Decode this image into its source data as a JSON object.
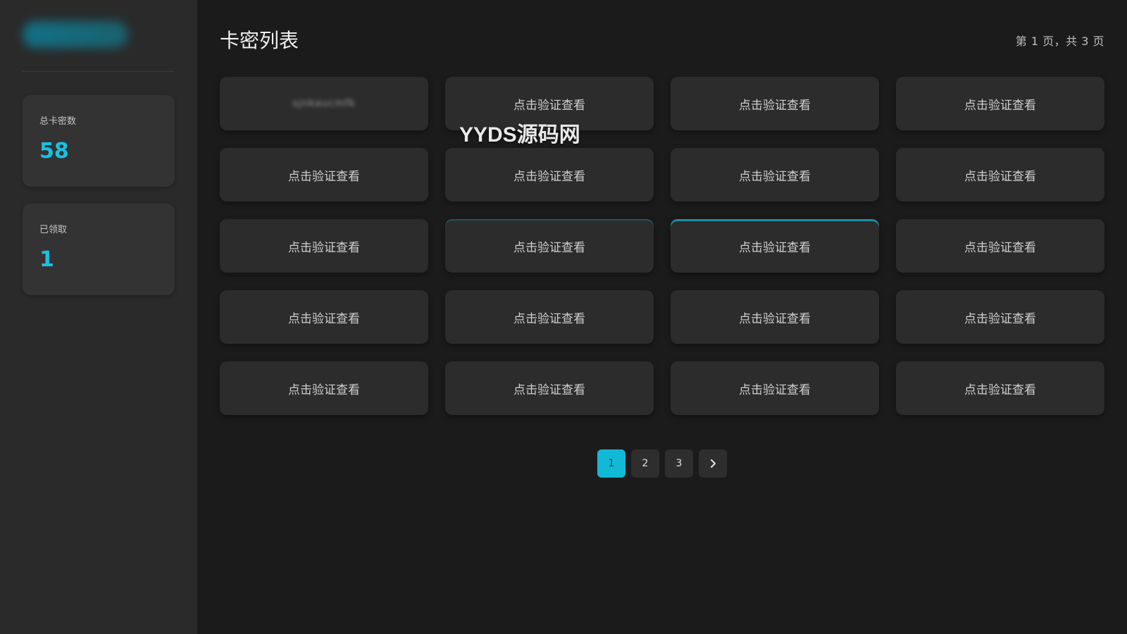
{
  "sidebar": {
    "stats": [
      {
        "label": "总卡密数",
        "value": "58"
      },
      {
        "label": "已领取",
        "value": "1"
      }
    ]
  },
  "main": {
    "title": "卡密列表",
    "page_info": "第 1 页，共 3 页",
    "watermark": "YYDS源码网",
    "cards": [
      {
        "label": "sjnkaucmfk"
      },
      {
        "label": "点击验证查看"
      },
      {
        "label": "点击验证查看"
      },
      {
        "label": "点击验证查看"
      },
      {
        "label": "点击验证查看"
      },
      {
        "label": "点击验证查看"
      },
      {
        "label": "点击验证查看"
      },
      {
        "label": "点击验证查看"
      },
      {
        "label": "点击验证查看"
      },
      {
        "label": "点击验证查看"
      },
      {
        "label": "点击验证查看"
      },
      {
        "label": "点击验证查看"
      },
      {
        "label": "点击验证查看"
      },
      {
        "label": "点击验证查看"
      },
      {
        "label": "点击验证查看"
      },
      {
        "label": "点击验证查看"
      },
      {
        "label": "点击验证查看"
      },
      {
        "label": "点击验证查看"
      },
      {
        "label": "点击验证查看"
      },
      {
        "label": "点击验证查看"
      }
    ],
    "pagination": {
      "pages": [
        "1",
        "2",
        "3"
      ],
      "next_icon": "chevron-right-icon"
    }
  },
  "colors": {
    "accent": "#12b9d6",
    "background": "#1b1b1b",
    "sidebar": "#2a2a2a",
    "card": "#2c2c2c"
  }
}
